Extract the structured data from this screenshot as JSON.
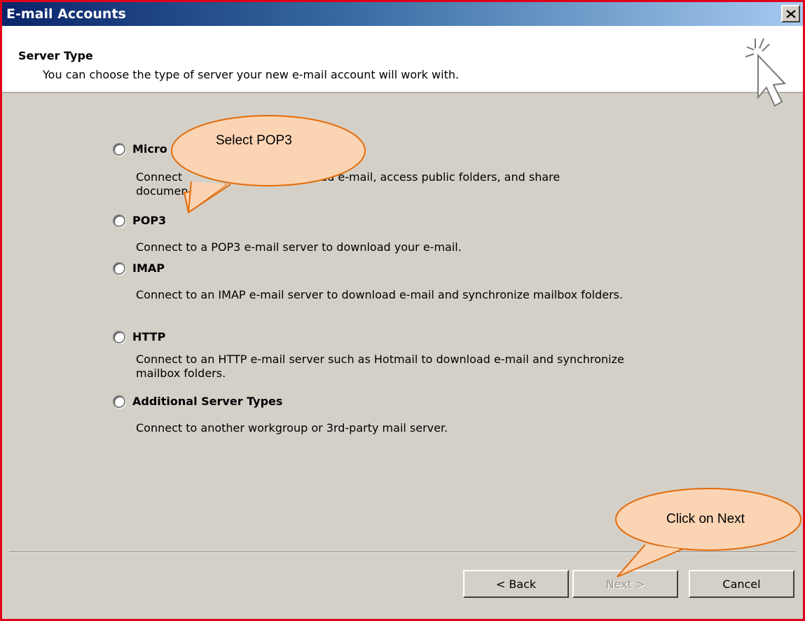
{
  "window": {
    "title": "E-mail Accounts"
  },
  "header": {
    "title": "Server Type",
    "subtitle": "You can choose the type of server your new e-mail account will work with."
  },
  "options": [
    {
      "label": "Micro",
      "description_line1": "Connect",
      "description_line1b": "to read e-mail, access public folders, and share",
      "description_line2": "documen"
    },
    {
      "label": "POP3",
      "description": "Connect to a POP3 e-mail server to download your e-mail."
    },
    {
      "label": "IMAP",
      "description": "Connect to an IMAP e-mail server to download e-mail and synchronize mailbox folders."
    },
    {
      "label": "HTTP",
      "description": "Connect to an HTTP e-mail server such as Hotmail to download e-mail and synchronize mailbox folders."
    },
    {
      "label": "Additional Server Types",
      "description": "Connect to another workgroup or 3rd-party mail server."
    }
  ],
  "buttons": {
    "back": "< Back",
    "next": "Next >",
    "cancel": "Cancel"
  },
  "callouts": {
    "select": "Select POP3",
    "click": "Click on Next"
  },
  "colors": {
    "callout_fill": "#fbd4b4",
    "callout_border": "#e36c0a",
    "window_border": "#e0001a"
  }
}
